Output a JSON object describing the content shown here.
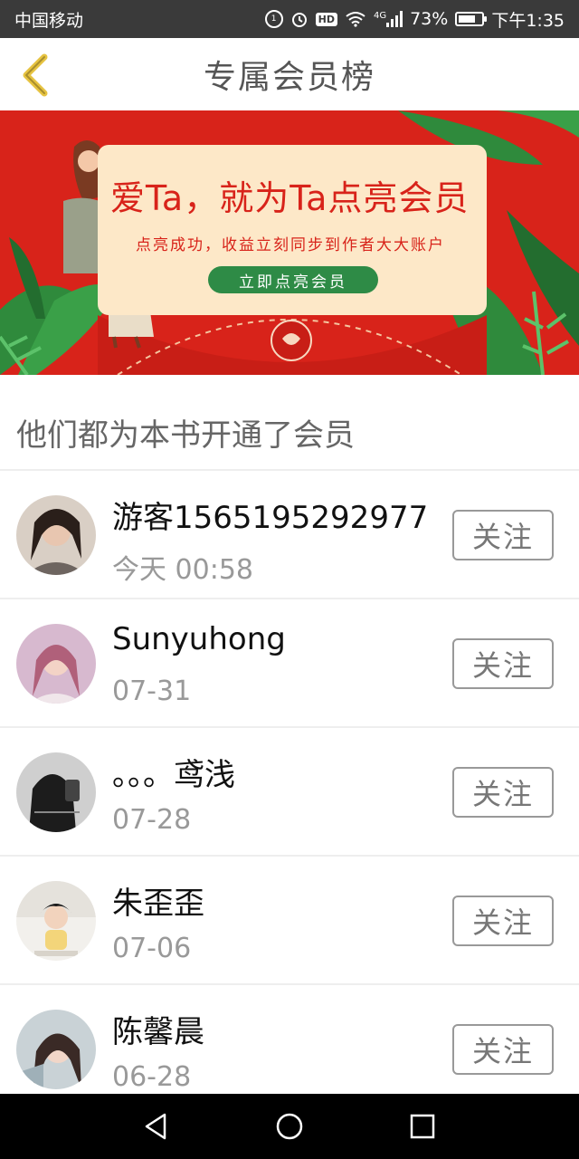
{
  "status_bar": {
    "carrier": "中国移动",
    "network": "4G",
    "battery": "73%",
    "battery_level": 0.73,
    "time": "下午1:35"
  },
  "header": {
    "title": "专属会员榜",
    "back_icon": "chevron-left-icon",
    "accent": "#e6c341"
  },
  "banner": {
    "title": "爱Ta，就为Ta点亮会员",
    "subtitle": "点亮成功，收益立刻同步到作者大大账户",
    "button_label": "立即点亮会员",
    "background": "#d8231a",
    "button_color": "#2e8b46"
  },
  "section": {
    "heading": "他们都为本书开通了会员"
  },
  "members": [
    {
      "name": "游客1565195292977",
      "date": "今天 00:58",
      "follow_label": "关注"
    },
    {
      "name": "Sunyuhong",
      "date": "07-31",
      "follow_label": "关注"
    },
    {
      "name": "。。。鸢浅",
      "date": "07-28",
      "follow_label": "关注"
    },
    {
      "name": "朱歪歪",
      "date": "07-06",
      "follow_label": "关注"
    },
    {
      "name": "陈馨晨",
      "date": "06-28",
      "follow_label": "关注"
    }
  ],
  "nav_bar": {
    "back_icon": "triangle-back-icon",
    "home_icon": "circle-home-icon",
    "recents_icon": "square-recents-icon"
  }
}
